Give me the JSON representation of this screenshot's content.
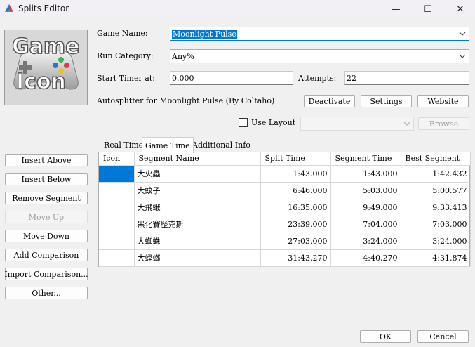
{
  "window": {
    "title": "Splits Editor",
    "minimize": "—",
    "maximize": "☐",
    "close": "✕"
  },
  "form": {
    "game_name_label": "Game Name:",
    "game_name_value": "Moonlight Pulse",
    "run_category_label": "Run Category:",
    "run_category_value": "Any%",
    "start_timer_label": "Start Timer at:",
    "start_timer_value": "0.000",
    "attempts_label": "Attempts:",
    "attempts_value": "22",
    "autosplitter_text": "Autosplitter for Moonlight Pulse (By Coltaho)",
    "deactivate_label": "Deactivate",
    "settings_label": "Settings",
    "website_label": "Website",
    "use_layout_label": "Use Layout",
    "layout_value": "",
    "browse_label": "Browse"
  },
  "side_buttons": [
    {
      "label": "Insert Above",
      "enabled": true
    },
    {
      "label": "Insert Below",
      "enabled": true
    },
    {
      "label": "Remove Segment",
      "enabled": true
    },
    {
      "label": "Move Up",
      "enabled": false
    },
    {
      "label": "Move Down",
      "enabled": true
    },
    {
      "label": "Add Comparison",
      "enabled": true
    },
    {
      "label": "Import Comparison...",
      "enabled": true
    },
    {
      "label": "Other...",
      "enabled": true
    }
  ],
  "tabs": [
    {
      "label": "Real Time",
      "active": false
    },
    {
      "label": "Game Time",
      "active": true
    },
    {
      "label": "Additional Info",
      "active": false
    }
  ],
  "table": {
    "columns": [
      "Icon",
      "Segment Name",
      "Split Time",
      "Segment Time",
      "Best Segment"
    ],
    "rows": [
      {
        "name": "大火蟲",
        "split": "1:43.000",
        "segment": "1:43.000",
        "best": "1:42.432"
      },
      {
        "name": "大蚊子",
        "split": "6:46.000",
        "segment": "5:03.000",
        "best": "5:00.577"
      },
      {
        "name": "大飛蛾",
        "split": "16:35.000",
        "segment": "9:49.000",
        "best": "9:33.413"
      },
      {
        "name": "黑化賽歷克斯",
        "split": "23:39.000",
        "segment": "7:04.000",
        "best": "7:03.000"
      },
      {
        "name": "大蜘蛛",
        "split": "27:03.000",
        "segment": "3:24.000",
        "best": "3:24.000"
      },
      {
        "name": "大螳螂",
        "split": "31:43.270",
        "segment": "4:40.270",
        "best": "4:31.874"
      }
    ]
  },
  "footer": {
    "ok_label": "OK",
    "cancel_label": "Cancel"
  },
  "game_icon": {
    "line1": "Game",
    "line2": "Icon"
  },
  "colors": {
    "selection": "#0078d7",
    "background": "#f0f0f0"
  }
}
